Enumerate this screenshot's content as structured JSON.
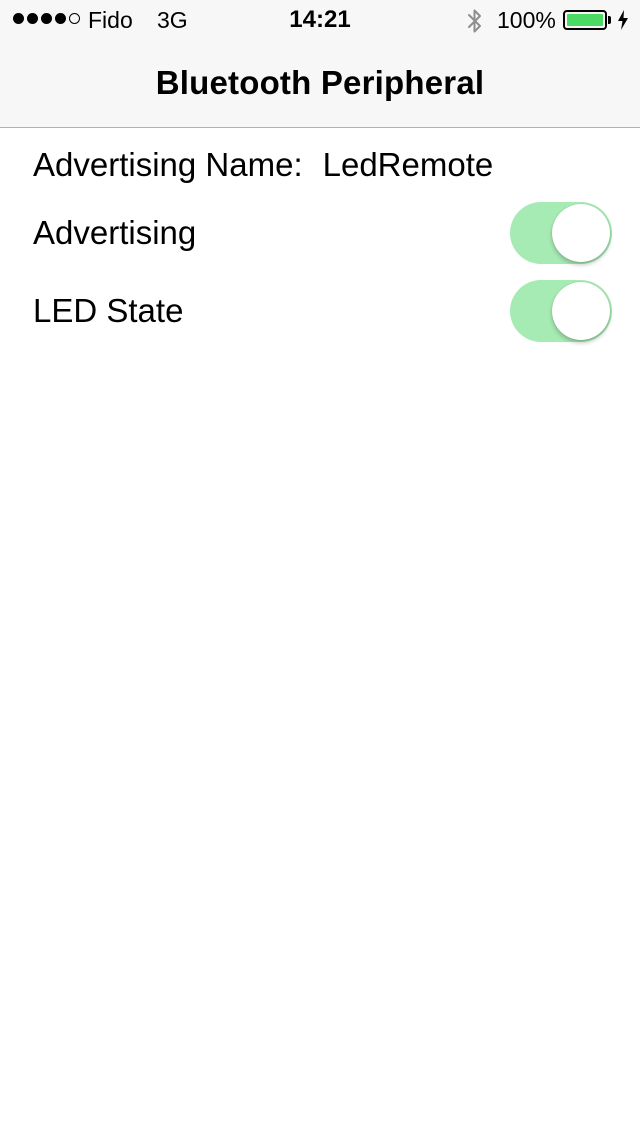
{
  "status_bar": {
    "signal_full_dots": 4,
    "signal_total_dots": 5,
    "carrier": "Fido",
    "network": "3G",
    "time": "14:21",
    "bluetooth_icon": "bluetooth-icon",
    "battery_percent": "100%",
    "battery_level": 1.0,
    "charging_icon": "charging-bolt-icon"
  },
  "nav": {
    "title": "Bluetooth Peripheral"
  },
  "content": {
    "advertising_name_label": "Advertising Name:",
    "advertising_name_value": "LedRemote",
    "advertising_label": "Advertising",
    "advertising_on": true,
    "led_state_label": "LED State",
    "led_state_on": true
  },
  "colors": {
    "switch_on": "#a6ebb3",
    "battery_fill": "#4cd964",
    "nav_background": "#f7f7f7"
  }
}
